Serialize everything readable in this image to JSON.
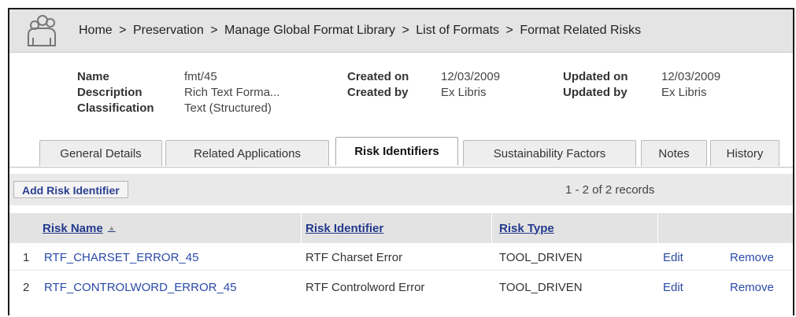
{
  "breadcrumb": [
    {
      "label": "Home"
    },
    {
      "label": "Preservation"
    },
    {
      "label": "Manage Global Format Library"
    },
    {
      "label": "List of Formats"
    },
    {
      "label": "Format Related Risks"
    }
  ],
  "breadcrumb_sep": ">",
  "details": {
    "name_label": "Name",
    "name_value": "fmt/45",
    "description_label": "Description",
    "description_value": "Rich Text Forma...",
    "classification_label": "Classification",
    "classification_value": "Text (Structured)",
    "created_on_label": "Created on",
    "created_on_value": "12/03/2009",
    "created_by_label": "Created by",
    "created_by_value": "Ex Libris",
    "updated_on_label": "Updated on",
    "updated_on_value": "12/03/2009",
    "updated_by_label": "Updated by",
    "updated_by_value": "Ex Libris"
  },
  "tabs": [
    {
      "label": "General Details"
    },
    {
      "label": "Related Applications"
    },
    {
      "label": "Risk Identifiers",
      "active": true
    },
    {
      "label": "Sustainability Factors"
    },
    {
      "label": "Notes"
    },
    {
      "label": "History"
    }
  ],
  "toolbar": {
    "add_label": "Add Risk Identifier",
    "records": "1 - 2 of 2 records"
  },
  "table": {
    "headers": [
      "Risk Name",
      "Risk Identifier",
      "Risk Type"
    ],
    "sort_indicator": "▲",
    "rows": [
      {
        "num": "1",
        "name": "RTF_CHARSET_ERROR_45",
        "identifier": "RTF Charset Error",
        "type": "TOOL_DRIVEN",
        "edit": "Edit",
        "remove": "Remove"
      },
      {
        "num": "2",
        "name": "RTF_CONTROLWORD_ERROR_45",
        "identifier": "RTF Controlword Error",
        "type": "TOOL_DRIVEN",
        "edit": "Edit",
        "remove": "Remove"
      }
    ]
  }
}
